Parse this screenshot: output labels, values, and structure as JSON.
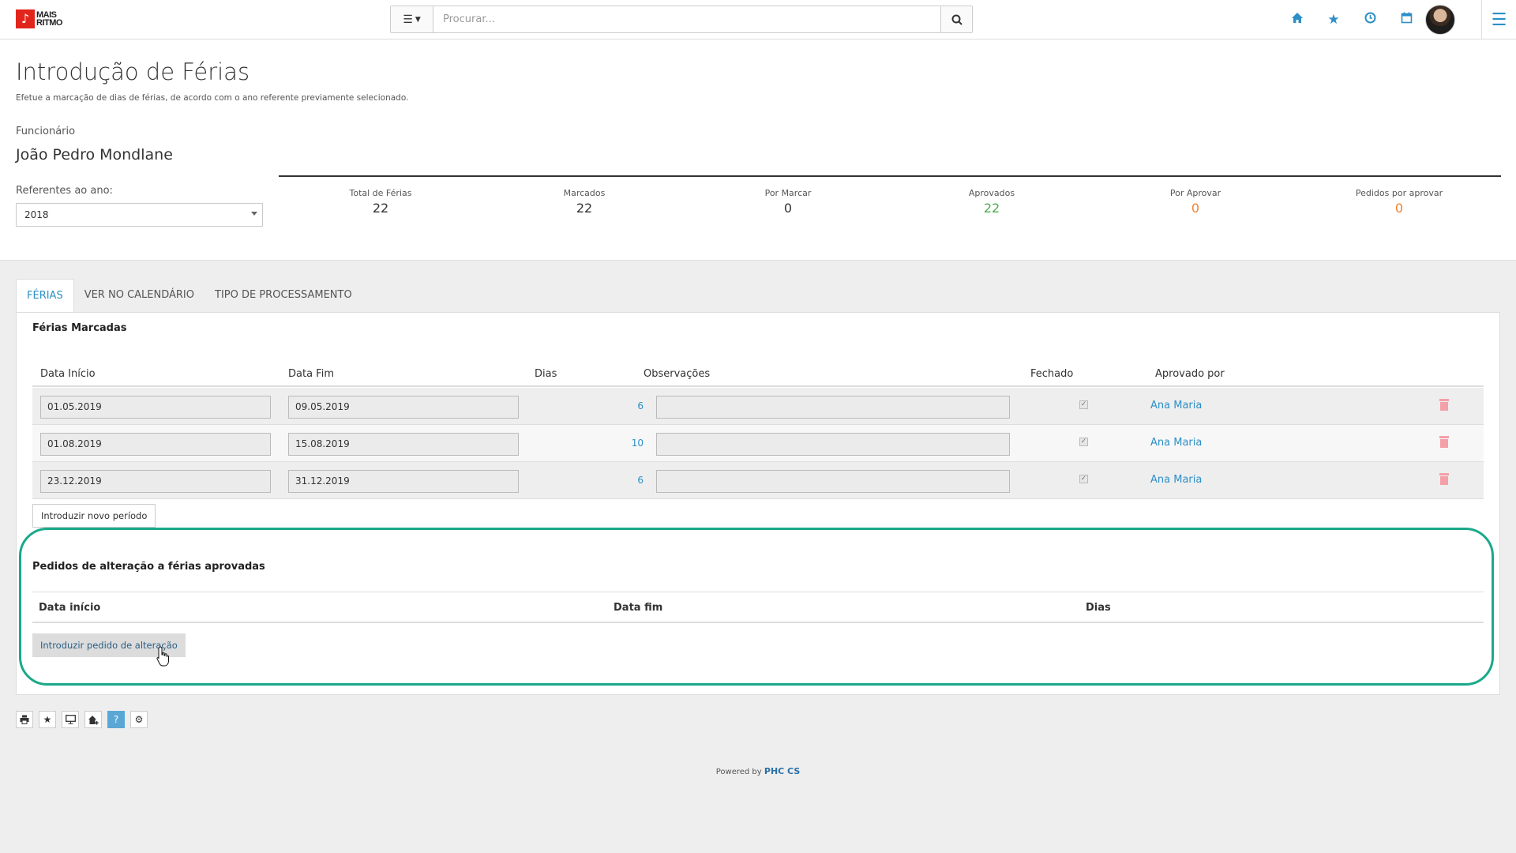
{
  "logo": {
    "line1": "MAIS",
    "line2": "RITMO"
  },
  "search": {
    "placeholder": "Procurar..."
  },
  "page": {
    "title": "Introdução de Férias",
    "subtitle": "Efetue a marcação de dias de férias, de acordo com o ano referente previamente selecionado.",
    "employee_label": "Funcionário",
    "employee_name": "João Pedro Mondlane",
    "year_label": "Referentes ao ano:",
    "year_value": "2018"
  },
  "stats": [
    {
      "label": "Total de Férias",
      "value": "22",
      "color": "#333333"
    },
    {
      "label": "Marcados",
      "value": "22",
      "color": "#333333"
    },
    {
      "label": "Por Marcar",
      "value": "0",
      "color": "#333333"
    },
    {
      "label": "Aprovados",
      "value": "22",
      "color": "#4cae4c"
    },
    {
      "label": "Por Aprovar",
      "value": "0",
      "color": "#f0812e"
    },
    {
      "label": "Pedidos por aprovar",
      "value": "0",
      "color": "#f0812e"
    }
  ],
  "tabs": [
    "FÉRIAS",
    "VER NO CALENDÁRIO",
    "TIPO DE PROCESSAMENTO"
  ],
  "ferias": {
    "title": "Férias Marcadas",
    "columns": [
      "Data Início",
      "Data Fim",
      "Dias",
      "Observações",
      "Fechado",
      "Aprovado por"
    ],
    "rows": [
      {
        "inicio": "01.05.2019",
        "fim": "09.05.2019",
        "dias": "6",
        "obs": "",
        "aprovado": "Ana Maria"
      },
      {
        "inicio": "01.08.2019",
        "fim": "15.08.2019",
        "dias": "10",
        "obs": "",
        "aprovado": "Ana Maria"
      },
      {
        "inicio": "23.12.2019",
        "fim": "31.12.2019",
        "dias": "6",
        "obs": "",
        "aprovado": "Ana Maria"
      }
    ],
    "new_button": "Introduzir novo período"
  },
  "pedidos": {
    "title": "Pedidos de alteração a férias aprovadas",
    "columns": [
      "Data início",
      "Data fim",
      "Dias"
    ],
    "button": "Introduzir pedido de alteração"
  },
  "footer": {
    "powered_prefix": "Powered by",
    "powered_brand": "PHC CS"
  },
  "icons": {
    "top": [
      "home-icon",
      "star-icon",
      "clock-icon",
      "calendar-icon"
    ],
    "bottom": [
      "print-icon",
      "star-icon",
      "monitor-icon",
      "home-add-icon",
      "help-icon",
      "gear-icon"
    ]
  }
}
